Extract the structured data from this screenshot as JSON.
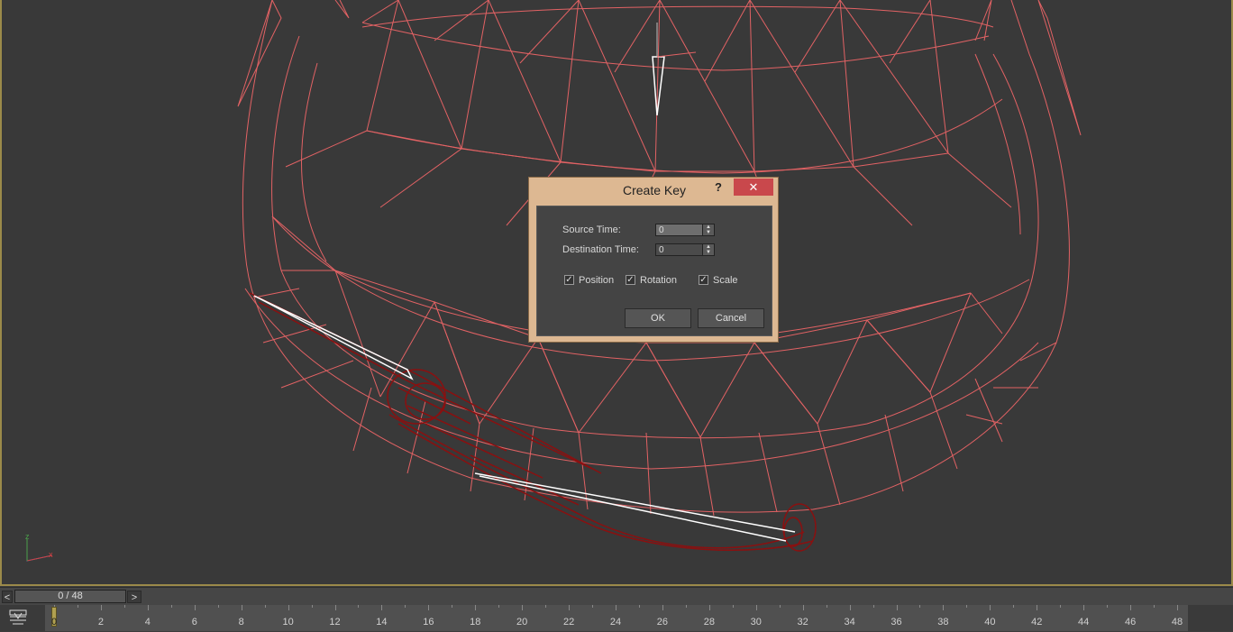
{
  "dialog": {
    "title": "Create Key",
    "help_label": "?",
    "close_label": "✕",
    "source_time_label": "Source Time:",
    "source_time_value": "0",
    "destination_time_label": "Destination Time:",
    "destination_time_value": "0",
    "position_label": "Position",
    "rotation_label": "Rotation",
    "scale_label": "Scale",
    "position_checked": true,
    "rotation_checked": true,
    "scale_checked": true,
    "ok_label": "OK",
    "cancel_label": "Cancel"
  },
  "gizmo": {
    "z_label": "z",
    "x_label": "x",
    "y_label": "y"
  },
  "time_slider": {
    "prev_label": "<",
    "next_label": ">",
    "frame_text": "0 / 48"
  },
  "trackbar": {
    "current_frame": 0,
    "ticks": [
      0,
      2,
      4,
      6,
      8,
      10,
      12,
      14,
      16,
      18,
      20,
      22,
      24,
      26,
      28,
      30,
      32,
      34,
      36,
      38,
      40,
      42,
      44,
      46,
      48
    ],
    "key_color": "#b0a050"
  },
  "colors": {
    "viewport_bg": "#393939",
    "wire_light": "#e8696b",
    "wire_dark": "#8a1010",
    "dialog_frame": "#ddb892",
    "close_red": "#c9484c"
  }
}
